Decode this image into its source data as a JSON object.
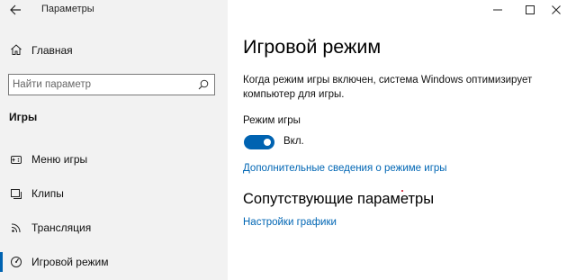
{
  "window": {
    "title": "Параметры",
    "controls": {
      "minimize": "minimize-icon",
      "maximize": "maximize-icon",
      "close": "close-icon"
    }
  },
  "sidebar": {
    "home_label": "Главная",
    "search_placeholder": "Найти параметр",
    "section_title": "Игры",
    "items": [
      {
        "label": "Меню игры",
        "icon": "xbox-icon",
        "active": false
      },
      {
        "label": "Клипы",
        "icon": "clips-icon",
        "active": false
      },
      {
        "label": "Трансляция",
        "icon": "broadcast-icon",
        "active": false
      },
      {
        "label": "Игровой режим",
        "icon": "game-mode-icon",
        "active": true
      }
    ]
  },
  "main": {
    "title": "Игровой режим",
    "description": "Когда режим игры включен, система Windows оптимизирует компьютер для игры.",
    "toggle": {
      "label": "Режим игры",
      "state_text": "Вкл.",
      "on": true
    },
    "more_info_link": "Дополнительные сведения о режиме игры",
    "related_title": "Сопутствующие параметры",
    "related_link": "Настройки графики"
  },
  "colors": {
    "accent": "#0063b1",
    "link": "#0066b4",
    "sidebar_bg": "#f2f2f2"
  }
}
